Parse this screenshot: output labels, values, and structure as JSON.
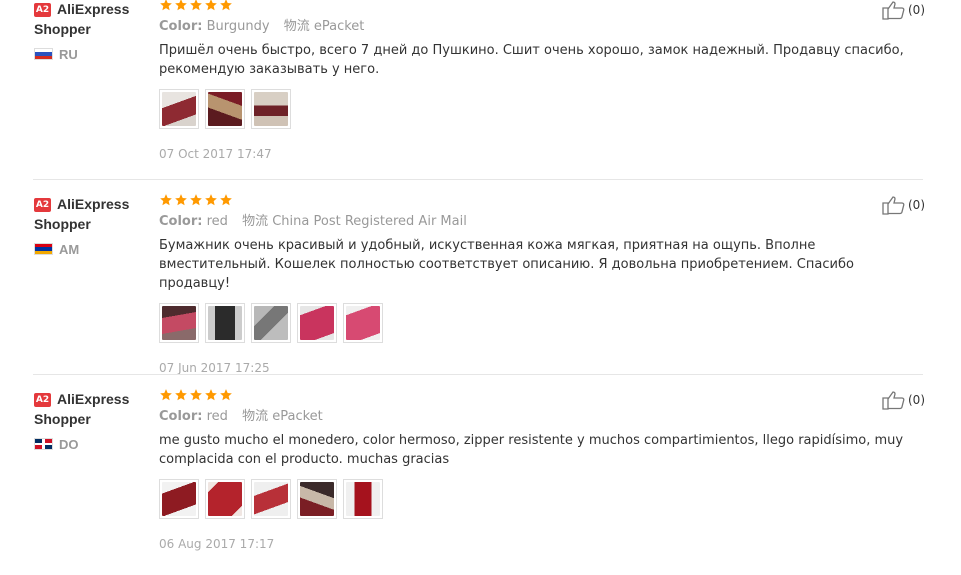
{
  "reviews": [
    {
      "badge": "A2",
      "name": "AliExpress Shopper",
      "country": "RU",
      "rating": 5,
      "color_label": "Color:",
      "color_value": "Burgundy",
      "ship_label": "物流",
      "ship_value": "ePacket",
      "text": "Пришёл очень быстро, всего 7 дней до Пушкино. Сшит очень хорошо, замок надежный. Продавцу спасибо, рекомендую заказывать у него.",
      "photos": 3,
      "date": "07 Oct 2017 17:47",
      "helpful": "(0)"
    },
    {
      "badge": "A2",
      "name": "AliExpress Shopper",
      "country": "AM",
      "rating": 5,
      "color_label": "Color:",
      "color_value": "red",
      "ship_label": "物流",
      "ship_value": "China Post Registered Air Mail",
      "text": "Бумажник очень красивый и удобный, искуственная кожа мягкая, приятная на ощупь. Вполне вместительный. Кошелек полностью соответствует описанию. Я довольна приобретением. Спасибо продавцу!",
      "photos": 5,
      "date": "07 Jun 2017 17:25",
      "helpful": "(0)"
    },
    {
      "badge": "A2",
      "name": "AliExpress Shopper",
      "country": "DO",
      "rating": 5,
      "color_label": "Color:",
      "color_value": "red",
      "ship_label": "物流",
      "ship_value": "ePacket",
      "text": "me gusto mucho el monedero, color hermoso, zipper resistente y muchos compartimientos, llego rapidísimo, muy complacida con el producto. muchas gracias",
      "photos": 5,
      "date": "06 Aug 2017 17:17",
      "helpful": "(0)"
    }
  ],
  "colors": {
    "badge": "#e4393c",
    "star": "#ff9900",
    "muted": "#999999"
  },
  "icons": {
    "star": "star-icon",
    "helpful": "thumbs-up-icon",
    "flag_ru": "russia-flag-icon",
    "flag_am": "armenia-flag-icon",
    "flag_do": "dominican-republic-flag-icon"
  }
}
